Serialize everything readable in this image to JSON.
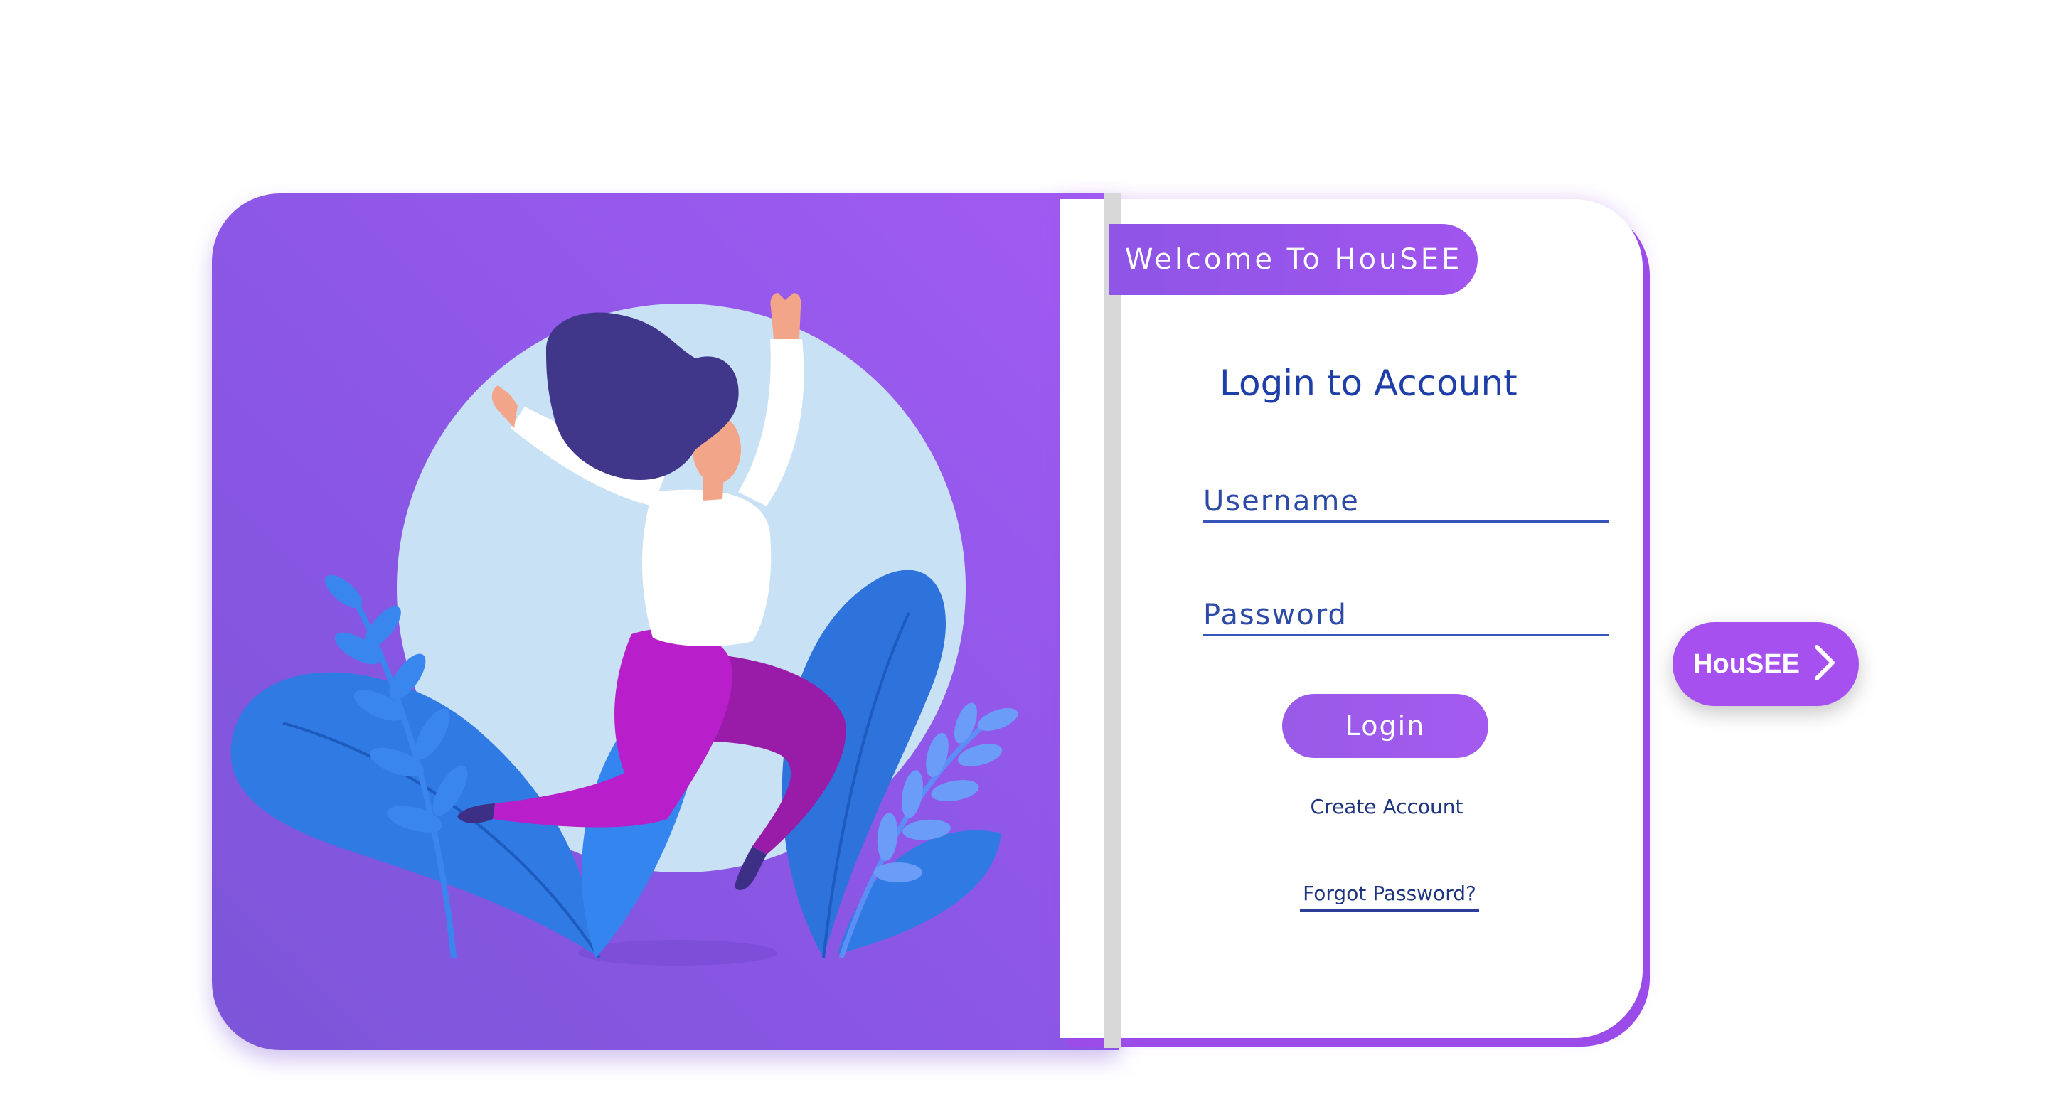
{
  "app": {
    "brand": "HouSEE"
  },
  "welcome_banner": {
    "text": "Welcome To HouSEE"
  },
  "login_form": {
    "title": "Login to Account",
    "username_placeholder": "Username",
    "password_placeholder": "Password",
    "login_button_label": "Login",
    "create_account_label": "Create Account",
    "forgot_password_label": "Forgot Password?"
  },
  "side_tab": {
    "label": "HouSEE",
    "icon": "chevron-right-icon"
  },
  "illustration": {
    "subject": "woman-jumping-illustration"
  },
  "colors": {
    "accent_purple": "#a055ee",
    "panel_gradient_start": "#a25bf3",
    "panel_gradient_end": "#7c55d8",
    "text_blue": "#1e3fa8",
    "circle_light_blue": "#c8e1f5",
    "leaf_blue": "#2f7be3"
  }
}
